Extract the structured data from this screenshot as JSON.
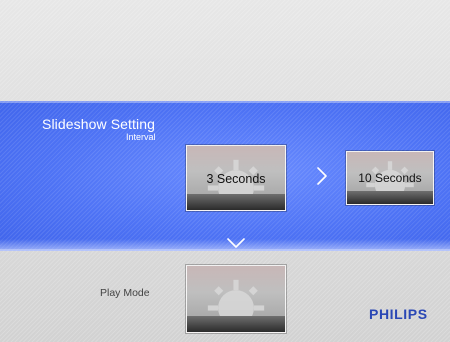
{
  "header": {
    "title": "Slideshow Setting",
    "subtitle": "Interval"
  },
  "interval": {
    "current_label": "3 Seconds",
    "next_label": "10 Seconds"
  },
  "play_mode": {
    "label": "Play Mode"
  },
  "brand": {
    "name": "PHILIPS"
  },
  "colors": {
    "band_blue": "#4e73f5",
    "brand_blue": "#2a47b5",
    "text_white": "#ffffff"
  },
  "icons": {
    "right_arrow": "chevron-right-icon",
    "down_arrow": "chevron-down-icon",
    "tile_graphic": "gear-icon"
  }
}
